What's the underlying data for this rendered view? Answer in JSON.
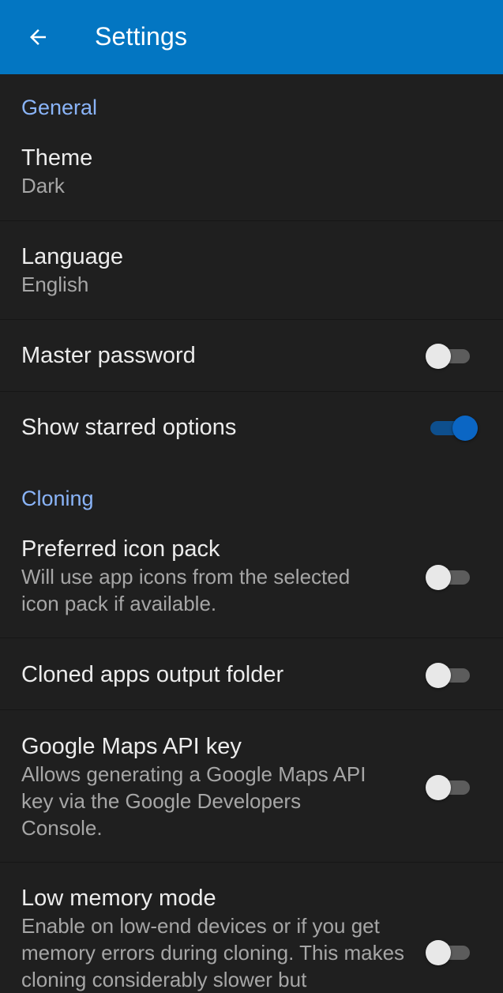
{
  "header": {
    "title": "Settings",
    "back_icon": "arrow-left-icon"
  },
  "colors": {
    "appbar": "#0376c2",
    "section_header": "#8ab4f8",
    "switch_on": "#0b66c4",
    "background": "#1f1f1f"
  },
  "general": {
    "header": "General",
    "theme": {
      "title": "Theme",
      "value": "Dark"
    },
    "language": {
      "title": "Language",
      "value": "English"
    },
    "master_password": {
      "title": "Master password",
      "enabled": false
    },
    "show_starred": {
      "title": "Show starred options",
      "enabled": true
    }
  },
  "cloning": {
    "header": "Cloning",
    "icon_pack": {
      "title": "Preferred icon pack",
      "subtitle": "Will use app icons from the selected icon pack if available.",
      "enabled": false
    },
    "output_folder": {
      "title": "Cloned apps output folder",
      "enabled": false
    },
    "maps_key": {
      "title": "Google Maps API key",
      "subtitle": "Allows generating a Google Maps API key via the Google Developers Console.",
      "enabled": false
    },
    "low_memory": {
      "title": "Low memory mode",
      "subtitle": "Enable on low-end devices or if you get memory errors during cloning. This makes cloning considerably slower but",
      "enabled": false
    }
  }
}
